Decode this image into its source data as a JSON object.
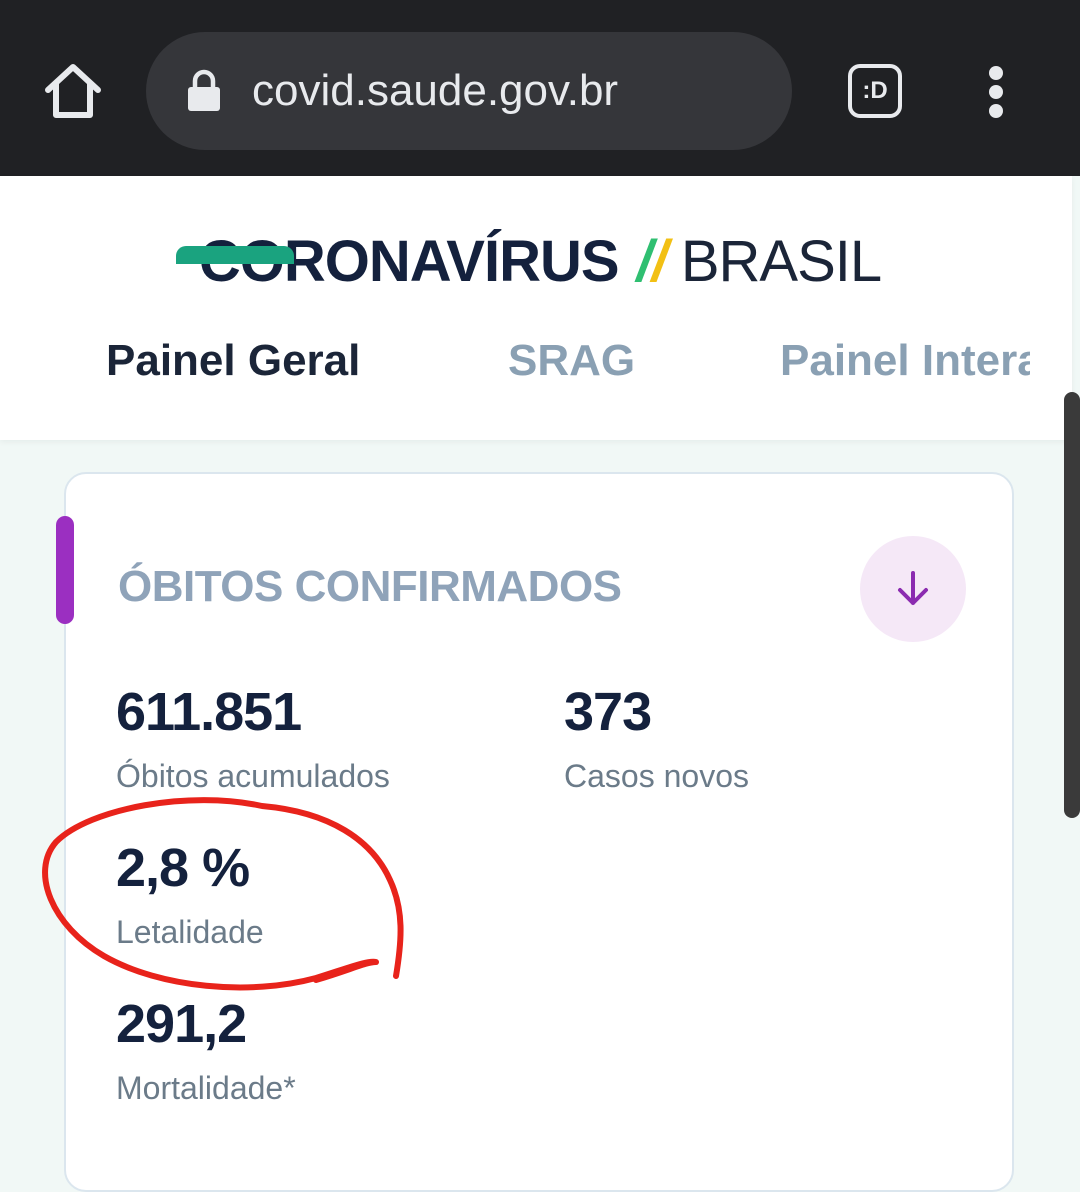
{
  "browser": {
    "url": "covid.saude.gov.br",
    "extension_label": ":D",
    "home_icon": "home-icon",
    "lock_icon": "lock-icon",
    "menu_icon": "more-vert-icon"
  },
  "header": {
    "logo_main": "CORONAVÍRUS",
    "logo_separator": "//",
    "logo_brand": "BRASIL",
    "tabs": [
      {
        "label": "Painel Geral",
        "active": true
      },
      {
        "label": "SRAG",
        "active": false
      },
      {
        "label": "Painel Interativo",
        "active": false
      }
    ]
  },
  "card": {
    "title": "ÓBITOS CONFIRMADOS",
    "download_icon": "arrow-down-icon",
    "stats": [
      {
        "value": "611.851",
        "label": "Óbitos acumulados"
      },
      {
        "value": "373",
        "label": "Casos novos"
      },
      {
        "value": "2,8 %",
        "label": "Letalidade"
      },
      {
        "value": "291,2",
        "label": "Mortalidade*"
      }
    ]
  },
  "colors": {
    "toolbar": "#202124",
    "accent_purple": "#9b2fc1",
    "tab_indicator": "#1aa37f",
    "logo_green": "#2fbf71",
    "logo_yellow": "#f2c014",
    "annotation_red": "#e8231b"
  }
}
